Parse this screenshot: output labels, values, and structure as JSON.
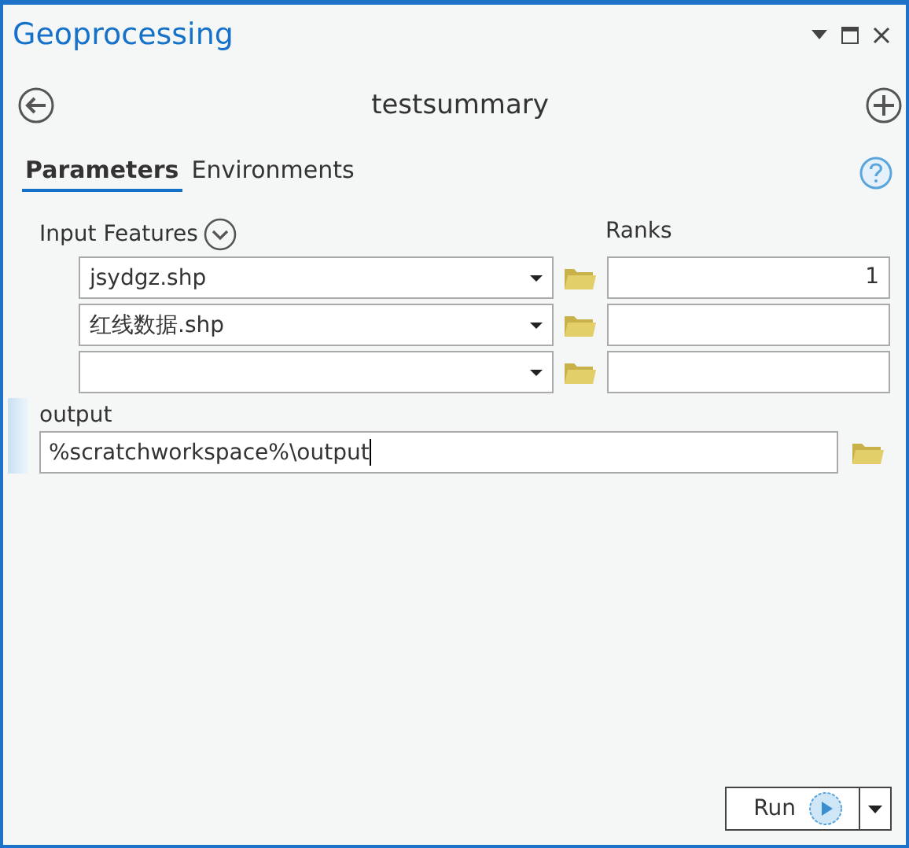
{
  "window": {
    "title": "Geoprocessing"
  },
  "tool": {
    "title": "testsummary"
  },
  "tabs": [
    {
      "label": "Parameters",
      "selected": true
    },
    {
      "label": "Environments",
      "selected": false
    }
  ],
  "input_features": {
    "label": "Input Features",
    "rows": [
      {
        "value": "jsydgz.shp",
        "rank": "1"
      },
      {
        "value": "红线数据.shp"
      },
      {
        "value": ""
      }
    ]
  },
  "ranks": {
    "label": "Ranks"
  },
  "output": {
    "label": "output",
    "value": "%scratchworkspace%\\output",
    "focused": true
  },
  "run_button": {
    "label": "Run"
  }
}
